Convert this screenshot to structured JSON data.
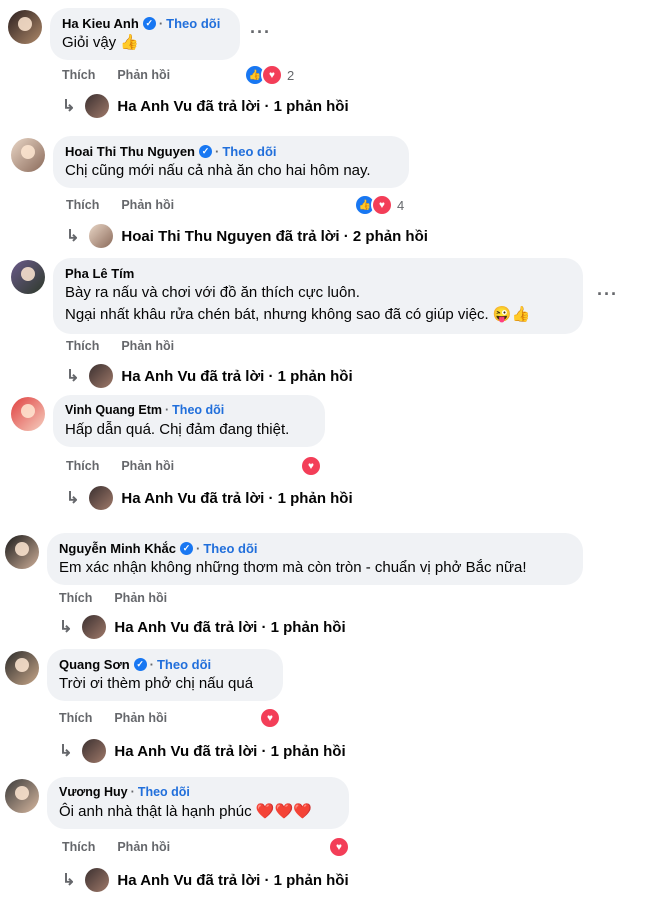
{
  "ui": {
    "follow_label": "Theo dõi",
    "like_label": "Thích",
    "reply_label": "Phản hồi",
    "more_label": "···",
    "dot": "·"
  },
  "comments": [
    {
      "author": "Ha Kieu Anh",
      "verified": true,
      "text": "Giỏi vậy",
      "emoji": "👍",
      "reactions": [
        "like",
        "love"
      ],
      "reaction_count": "2",
      "reply_summary": "Ha Anh Vu đã trả lời · 1 phản hồi"
    },
    {
      "author": "Hoai Thi Thu Nguyen",
      "verified": true,
      "text": "Chị cũng mới nấu cả nhà ăn cho hai hôm nay.",
      "reactions": [
        "like",
        "love"
      ],
      "reaction_count": "4",
      "reply_summary": "Hoai Thi Thu Nguyen đã trả lời · 2 phản hồi"
    },
    {
      "author": "Pha Lê Tím",
      "verified": false,
      "text_line1": "Bày ra nấu và chơi với đồ ăn thích cực luôn.",
      "text_line2": "Ngại nhất khâu rửa chén bát, nhưng không sao đã có giúp việc.",
      "emoji": "😜👍",
      "reply_summary": "Ha Anh Vu đã trả lời · 1 phản hồi"
    },
    {
      "author": "Vinh Quang Etm",
      "verified": false,
      "text": "Hấp dẫn quá. Chị đảm đang thiệt.",
      "reactions": [
        "love"
      ],
      "reply_summary": "Ha Anh Vu đã trả lời · 1 phản hồi"
    },
    {
      "author": "Nguyễn Minh Khắc",
      "verified": true,
      "text": "Em xác nhận không những thơm mà còn tròn - chuẩn vị phở Bắc nữa!",
      "reply_summary": "Ha Anh Vu đã trả lời · 1 phản hồi"
    },
    {
      "author": "Quang Sơn",
      "verified": true,
      "text": "Trời ơi thèm phở chị nấu quá",
      "reactions": [
        "love"
      ],
      "reply_summary": "Ha Anh Vu đã trả lời · 1 phản hồi"
    },
    {
      "author": "Vương Huy",
      "verified": false,
      "text": "Ôi anh nhà thật là hạnh phúc",
      "emoji": "❤️❤️❤️",
      "reactions": [
        "love"
      ],
      "reply_summary": "Ha Anh Vu đã trả lời · 1 phản hồi"
    }
  ],
  "colors": {
    "bubble": "#f0f2f5",
    "follow": "#216fdb",
    "like": "#1877f2",
    "love": "#f33e58",
    "secondary_text": "#65676b"
  }
}
